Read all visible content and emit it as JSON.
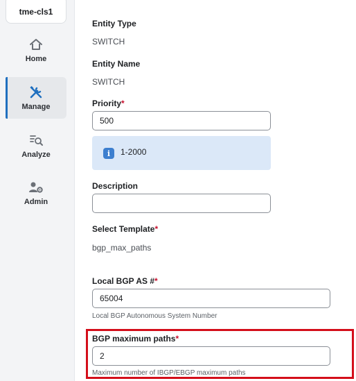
{
  "sidebar": {
    "cluster": "tme-cls1",
    "items": [
      {
        "label": "Home",
        "icon": "home-icon"
      },
      {
        "label": "Manage",
        "icon": "tools-icon"
      },
      {
        "label": "Analyze",
        "icon": "analyze-icon"
      },
      {
        "label": "Admin",
        "icon": "admin-icon"
      }
    ],
    "active_color": "#1f6fbf"
  },
  "form": {
    "entity_type": {
      "label": "Entity Type",
      "value": "SWITCH"
    },
    "entity_name": {
      "label": "Entity Name",
      "value": "SWITCH"
    },
    "priority": {
      "label": "Priority",
      "required": "*",
      "value": "500",
      "info": "1-2000"
    },
    "description": {
      "label": "Description",
      "value": ""
    },
    "template": {
      "label": "Select Template",
      "required": "*",
      "value": "bgp_max_paths"
    },
    "local_bgp_as": {
      "label": "Local BGP AS #",
      "required": "*",
      "value": "65004",
      "helper": "Local BGP Autonomous System Number"
    },
    "bgp_max_paths": {
      "label": "BGP maximum paths",
      "required": "*",
      "value": "2",
      "helper": "Maximum number of IBGP/EBGP maximum paths"
    }
  },
  "colors": {
    "required": "#c8102e",
    "highlight": "#d40e1a",
    "info_bg": "#dbe8f8"
  }
}
